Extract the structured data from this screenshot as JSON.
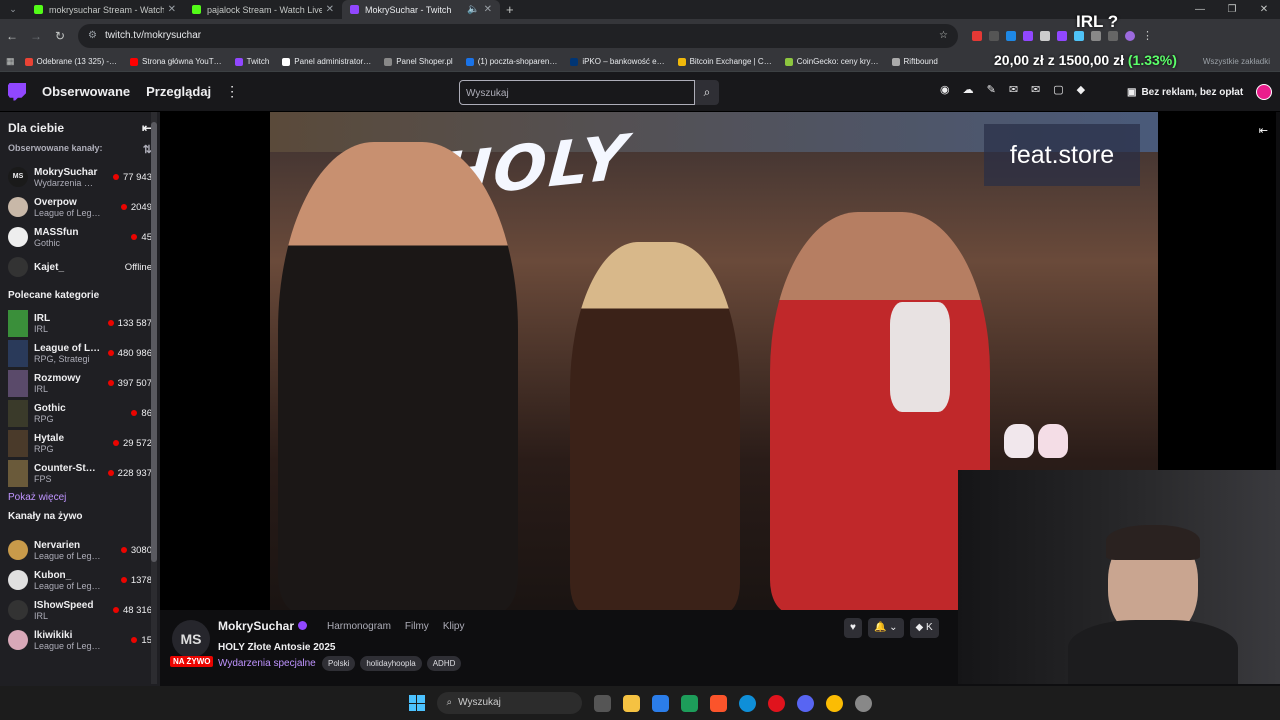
{
  "browser": {
    "tabs": [
      {
        "title": "mokrysuchar Stream - Watch Li",
        "active": false,
        "color": "#53fc18"
      },
      {
        "title": "pajalock Stream - Watch Live o",
        "active": false,
        "color": "#53fc18"
      },
      {
        "title": "MokrySuchar - Twitch",
        "active": true,
        "color": "#9147ff"
      }
    ],
    "url": "twitch.tv/mokrysuchar",
    "bookmarks": [
      {
        "label": "Odebrane (13 325) -…",
        "color": "#ea4335"
      },
      {
        "label": "Strona główna YouT…",
        "color": "#ff0000"
      },
      {
        "label": "Twitch",
        "color": "#9147ff"
      },
      {
        "label": "Panel administrator…",
        "color": "#ffffff"
      },
      {
        "label": "Panel Shoper.pl",
        "color": "#888888"
      },
      {
        "label": "(1) poczta-shoparen…",
        "color": "#1a73e8"
      },
      {
        "label": "iPKO – bankowość e…",
        "color": "#003574"
      },
      {
        "label": "Bitcoin Exchange | C…",
        "color": "#f0b90b"
      },
      {
        "label": "CoinGecko: ceny kry…",
        "color": "#8dc63f"
      },
      {
        "label": "Riftbound",
        "color": "#aaaaaa"
      }
    ],
    "bookmarks_right": "Wszystkie zakładki"
  },
  "twitch_nav": {
    "followed": "Obserwowane",
    "browse": "Przeglądaj",
    "search_placeholder": "Wyszukaj",
    "adfree": "Bez reklam, bez opłat"
  },
  "sidebar": {
    "title": "Dla ciebie",
    "followed_label": "Obserwowane kanały:",
    "followed": [
      {
        "name": "MokrySuchar",
        "game": "Wydarzenia …",
        "viewers": "77 943",
        "live": true,
        "av": "MS"
      },
      {
        "name": "Overpow",
        "game": "League of Leg…",
        "viewers": "2049",
        "live": true,
        "av": ""
      },
      {
        "name": "MASSfun",
        "game": "Gothic",
        "viewers": "45",
        "live": true,
        "av": ""
      },
      {
        "name": "Kajet_",
        "game": "",
        "viewers": "Offline",
        "live": false,
        "av": ""
      }
    ],
    "categories_label": "Polecane kategorie",
    "categories": [
      {
        "name": "IRL",
        "sub": "IRL",
        "viewers": "133 587",
        "color": "#3a8f3a"
      },
      {
        "name": "League of L…",
        "sub": "RPG, Strategi",
        "viewers": "480 986",
        "color": "#2a3a5a"
      },
      {
        "name": "Rozmowy",
        "sub": "IRL",
        "viewers": "397 507",
        "color": "#5a4a6a"
      },
      {
        "name": "Gothic",
        "sub": "RPG",
        "viewers": "86",
        "color": "#3a3a2a"
      },
      {
        "name": "Hytale",
        "sub": "RPG",
        "viewers": "29 572",
        "color": "#4a3a2a"
      },
      {
        "name": "Counter-St…",
        "sub": "FPS",
        "viewers": "228 937",
        "color": "#6a5a3a"
      }
    ],
    "show_more": "Pokaż więcej",
    "live_label": "Kanały na żywo",
    "live": [
      {
        "name": "Nervarien",
        "game": "League of Leg…",
        "viewers": "3080"
      },
      {
        "name": "Kubon_",
        "game": "League of Leg…",
        "viewers": "1378"
      },
      {
        "name": "IShowSpeed",
        "game": "IRL",
        "viewers": "48 316"
      },
      {
        "name": "lkiwikiki",
        "game": "League of Leg…",
        "viewers": "15"
      }
    ]
  },
  "overlay": {
    "brand": "feat.store",
    "holy": "HOLY",
    "irl": "IRL ?",
    "price_a": "20,00 zł",
    "price_sep": "z",
    "price_b": "1500,00 zł",
    "price_pct": "(1.33%)"
  },
  "channel": {
    "name": "MokrySuchar",
    "av": "MS",
    "live": "NA ŻYWO",
    "tabs": [
      "Harmonogram",
      "Filmy",
      "Klipy"
    ],
    "title": "HOLY Złote Antosie 2025",
    "category": "Wydarzenia specjalne",
    "tags": [
      "Polski",
      "holidayhoopla",
      "ADHD"
    ]
  },
  "taskbar": {
    "search": "Wyszukaj"
  }
}
